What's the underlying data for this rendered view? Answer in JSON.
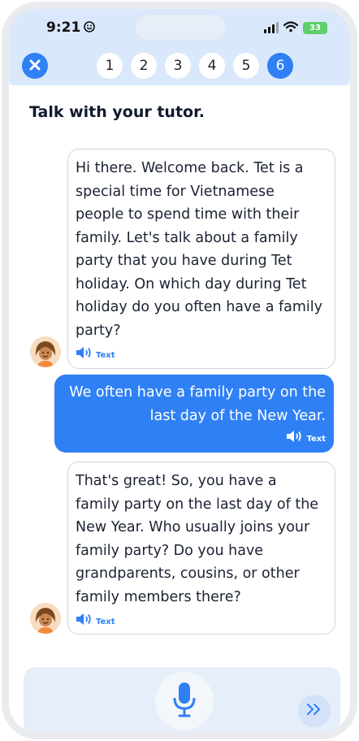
{
  "status_bar": {
    "time": "9:21",
    "battery": "33"
  },
  "progress": {
    "steps": [
      "1",
      "2",
      "3",
      "4",
      "5",
      "6"
    ],
    "active_step": "6"
  },
  "page": {
    "title": "Talk with your tutor."
  },
  "messages": [
    {
      "sender": "tutor",
      "text": "Hi there. Welcome back. Tet is a special time for Vietnamese people to spend time with their family. Let's talk about a family party that you have during Tet holiday. On which day during Tet holiday do you often have a family party?",
      "audio_label": "Text"
    },
    {
      "sender": "user",
      "text": "We often have a family party on the last day of the New Year.",
      "audio_label": "Text"
    },
    {
      "sender": "tutor",
      "text": "That's great! So, you have a family party on the last day of the New Year. Who usually joins your family party? Do you have grandparents, cousins, or other family members there?",
      "audio_label": "Text"
    }
  ],
  "colors": {
    "accent": "#2f80f5",
    "header_bg": "#d9e8fb",
    "bubble_border": "#cfd6df"
  },
  "icons": {
    "close": "close-icon",
    "speaker": "speaker-icon",
    "mic": "microphone-icon",
    "skip": "double-chevron-right-icon"
  }
}
